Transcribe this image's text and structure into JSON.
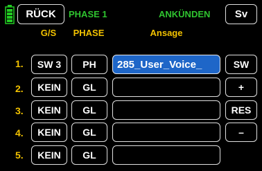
{
  "header": {
    "back_label": "RÜCK",
    "phase_label": "PHASE 1",
    "announce_label": "ANKÜNDEN",
    "sv_label": "Sv"
  },
  "columns": {
    "gs": "G/S",
    "phase": "PHASE",
    "ansage": "Ansage"
  },
  "rows": [
    {
      "num": "1.",
      "gs": "SW 3",
      "phase": "PH",
      "ansage": "285_User_Voice_"
    },
    {
      "num": "2.",
      "gs": "KEIN",
      "phase": "GL",
      "ansage": ""
    },
    {
      "num": "3.",
      "gs": "KEIN",
      "phase": "GL",
      "ansage": ""
    },
    {
      "num": "4.",
      "gs": "KEIN",
      "phase": "GL",
      "ansage": ""
    },
    {
      "num": "5.",
      "gs": "KEIN",
      "phase": "GL",
      "ansage": ""
    }
  ],
  "side_buttons": {
    "sw": "SW",
    "plus": "+",
    "res": "RES",
    "minus": "–"
  },
  "colors": {
    "label_yellow": "#f2c200",
    "title_green": "#2fc42f",
    "selection_blue": "#1e66c8",
    "battery_green": "#22cc22"
  }
}
